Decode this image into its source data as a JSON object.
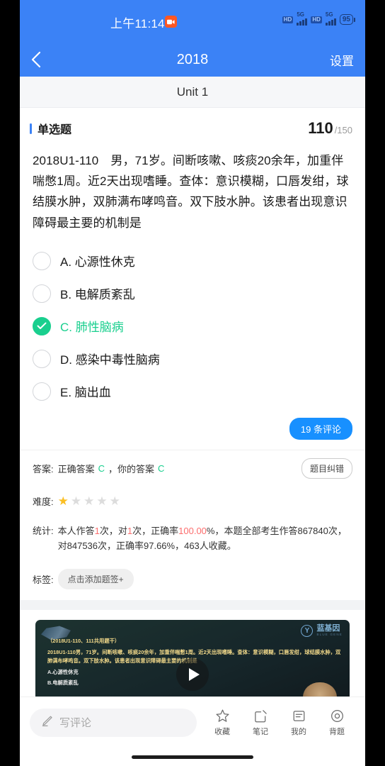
{
  "status_bar": {
    "time": "上午11:14",
    "video_icon": "video-camera-icon",
    "sim1": {
      "hd": "HD",
      "network": "5G"
    },
    "sim2": {
      "hd": "HD",
      "network": "5G"
    },
    "battery": "95"
  },
  "nav": {
    "back_icon": "chevron-left-icon",
    "title": "2018",
    "settings_label": "设置"
  },
  "unit": {
    "label": "Unit 1"
  },
  "question": {
    "type_label": "单选题",
    "current": "110",
    "total": "/150",
    "text": "2018U1-110　男，71岁。间断咳嗽、咳痰20余年，加重伴喘憋1周。近2天出现嗜睡。查体：意识模糊，口唇发绀，球结膜水肿，双肺满布哮鸣音。双下肢水肿。该患者出现意识障碍最主要的机制是",
    "options": [
      {
        "key": "A",
        "label": "A. 心源性休克",
        "selected": false
      },
      {
        "key": "B",
        "label": "B. 电解质紊乱",
        "selected": false
      },
      {
        "key": "C",
        "label": "C. 肺性脑病",
        "selected": true
      },
      {
        "key": "D",
        "label": "D. 感染中毒性脑病",
        "selected": false
      },
      {
        "key": "E",
        "label": "E. 脑出血",
        "selected": false
      }
    ],
    "check_icon": "check-icon"
  },
  "comments_badge": {
    "label": "19 条评论"
  },
  "answer": {
    "label": "答案:",
    "correct_prefix": "正确答案",
    "correct_value": "C",
    "your_prefix": "，你的答案",
    "your_value": "C",
    "report_button": "题目纠错"
  },
  "difficulty": {
    "label": "难度:",
    "filled": 1,
    "total": 5,
    "star_glyph": "★"
  },
  "statistics": {
    "label": "统计:",
    "self_prefix": "本人作答",
    "self_count": "1",
    "self_mid": "次，对",
    "self_correct": "1",
    "self_mid2": "次，正确率",
    "self_rate": "100.00",
    "self_suffix": "%，本题全部考生作答",
    "all_text": "867840次，对847536次，正确率97.66%，463人收藏。"
  },
  "tags": {
    "label": "标签:",
    "add_button": "点击添加题签+"
  },
  "video": {
    "logo_mark": "Y",
    "logo_cn": "蓝基因",
    "logo_en": "BLUE GENE",
    "slide_title": "（2018U1-110、111共用题干）",
    "slide_body": "2018U1-110男，71岁。间断咳嗽、咳痰20余年，加重伴喘憋1周。近2天出现嗜睡。查体：意识模糊，口唇发绀，球结膜水肿，双肺满布哮鸣音。双下肢水肿。该患者出现意识障碍最主要的机制是",
    "slide_opt_a": "A.心源性休克",
    "slide_opt_b": "B.电解质紊乱",
    "play_icon": "play-icon"
  },
  "bottom": {
    "comment_placeholder": "写评论",
    "pencil_icon": "pencil-icon",
    "tools": [
      {
        "icon": "star-icon",
        "label": "收藏"
      },
      {
        "icon": "note-edit-icon",
        "label": "笔记"
      },
      {
        "icon": "list-box-icon",
        "label": "我的"
      },
      {
        "icon": "eye-icon",
        "label": "背题"
      }
    ]
  },
  "colors": {
    "brand_blue": "#3b82f6",
    "accent_blue": "#1890ff",
    "correct_green": "#19cf8e",
    "stat_pink": "#fc6d6d",
    "star_yellow": "#fbbf24"
  }
}
